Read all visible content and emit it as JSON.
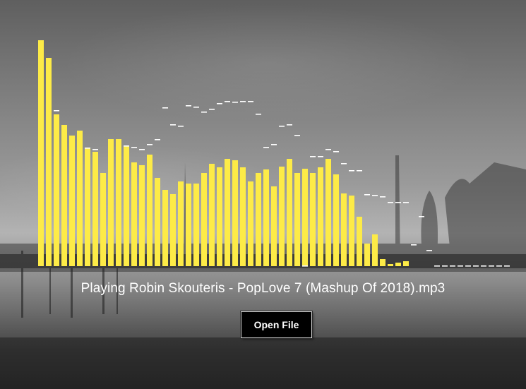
{
  "player": {
    "status_text": "Playing Robin Skouteris - PopLove 7 (Mashup Of 2018).mp3",
    "open_file_label": "Open File"
  },
  "colors": {
    "bar": "#fdeb47",
    "peak": "#ffffff",
    "button_bg": "#000000",
    "button_text": "#ffffff"
  },
  "chart_data": {
    "type": "bar",
    "title": "",
    "xlabel": "",
    "ylabel": "",
    "ylim": [
      0,
      320
    ],
    "series": [
      {
        "values": [
          320,
          295,
          215,
          200,
          185,
          192,
          168,
          162,
          132,
          180,
          180,
          170,
          147,
          143,
          158,
          125,
          108,
          102,
          120,
          117,
          117,
          132,
          145,
          140,
          152,
          150,
          140,
          120,
          132,
          137,
          113,
          141,
          152,
          132,
          138,
          132,
          140,
          152,
          130,
          103,
          100,
          70,
          32,
          45,
          10,
          3,
          5,
          7,
          0,
          0,
          0,
          0,
          0,
          0,
          0,
          0,
          0,
          0,
          0,
          0
        ]
      },
      {
        "values": [
          null,
          null,
          220,
          null,
          null,
          null,
          167,
          165,
          null,
          null,
          null,
          170,
          168,
          165,
          172,
          179,
          224,
          200,
          198,
          227,
          225,
          218,
          222,
          230,
          233,
          232,
          233,
          233,
          215,
          168,
          172,
          198,
          200,
          185,
          0,
          155,
          155,
          165,
          162,
          145,
          135,
          135,
          101,
          100,
          98,
          90,
          90,
          90,
          30,
          70,
          22,
          0,
          0,
          0,
          0,
          0,
          0,
          0,
          0,
          0,
          0
        ]
      }
    ]
  }
}
